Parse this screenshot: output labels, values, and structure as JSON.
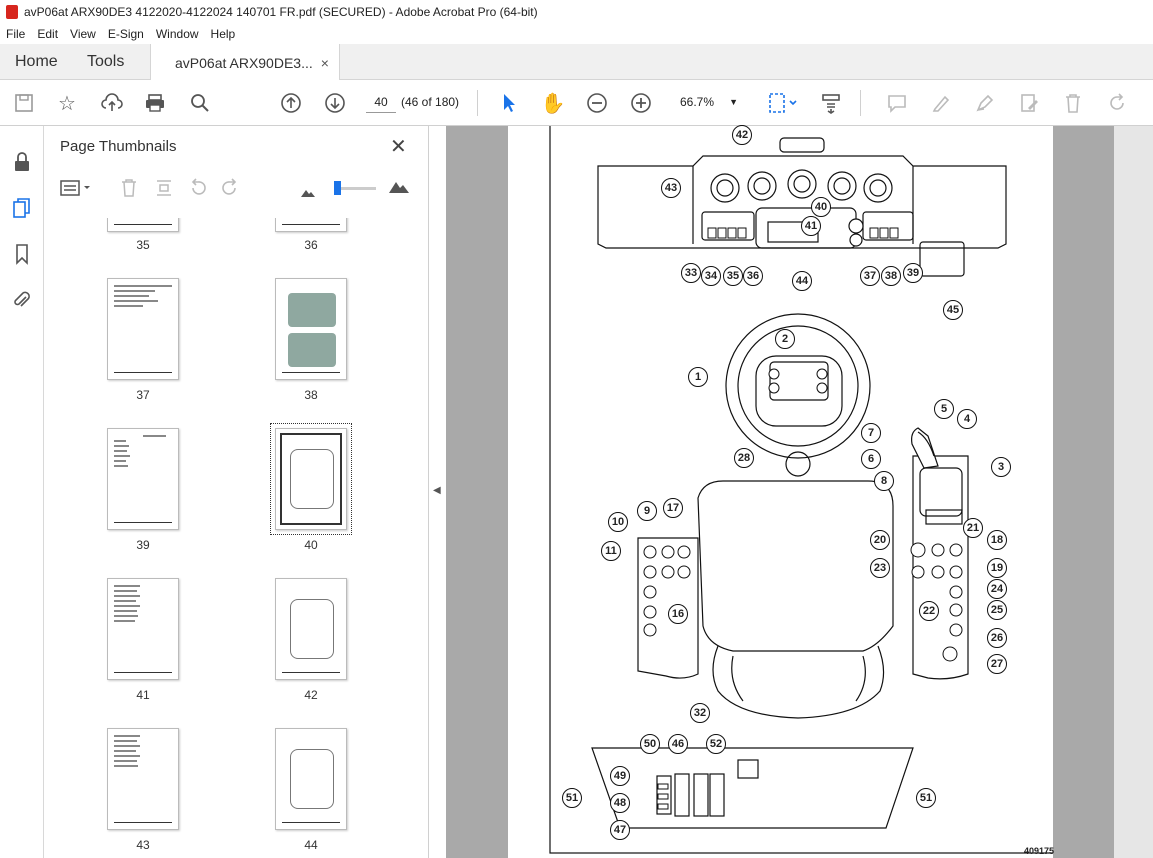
{
  "window": {
    "title": "avP06at ARX90DE3 4122020-4122024 140701 FR.pdf (SECURED) - Adobe Acrobat Pro (64-bit)"
  },
  "menu": [
    "File",
    "Edit",
    "View",
    "E-Sign",
    "Window",
    "Help"
  ],
  "tabs": {
    "home": "Home",
    "tools": "Tools",
    "doc": "avP06at ARX90DE3...",
    "close": "×"
  },
  "toolbar": {
    "page_value": "40",
    "page_count": "(46 of 180)",
    "zoom": "66.7%"
  },
  "panel": {
    "title": "Page Thumbnails",
    "close": "✕",
    "thumbs": [
      {
        "label": "35"
      },
      {
        "label": "36"
      },
      {
        "label": "37"
      },
      {
        "label": "38"
      },
      {
        "label": "39"
      },
      {
        "label": "40"
      },
      {
        "label": "41"
      },
      {
        "label": "42"
      },
      {
        "label": "43"
      },
      {
        "label": "44"
      }
    ]
  },
  "diagram": {
    "callouts": [
      "1",
      "2",
      "3",
      "4",
      "5",
      "6",
      "7",
      "8",
      "9",
      "10",
      "11",
      "16",
      "17",
      "18",
      "19",
      "20",
      "21",
      "22",
      "23",
      "24",
      "25",
      "26",
      "27",
      "28",
      "32",
      "33",
      "34",
      "35",
      "36",
      "37",
      "38",
      "39",
      "40",
      "41",
      "42",
      "43",
      "44",
      "45",
      "46",
      "47",
      "48",
      "49",
      "50",
      "51",
      "52"
    ],
    "doc_number": "409175"
  }
}
